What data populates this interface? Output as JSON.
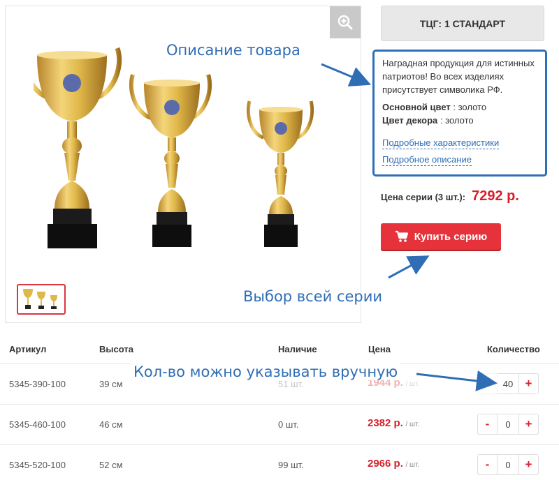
{
  "series_tag": "ТЦГ: 1 СТАНДАРТ",
  "description": {
    "text": "Наградная продукция для истинных патриотов! Во всех изделиях присутствует символика РФ.",
    "main_color_label": "Основной цвет",
    "main_color_value": ": золото",
    "decor_color_label": "Цвет декора",
    "decor_color_value": ": золото",
    "link_specs": "Подробные характеристики",
    "link_description": "Подробное описание"
  },
  "price": {
    "label": "Цена серии (3 шт.):",
    "value": "7292 р."
  },
  "buy_button": "Купить серию",
  "annotations": {
    "description": "Описание товара",
    "series": "Выбор всей серии",
    "quantity": "Кол-во можно указывать вручную"
  },
  "table": {
    "headers": {
      "article": "Артикул",
      "height": "Высота",
      "stock": "Наличие",
      "price": "Цена",
      "quantity": "Количество"
    },
    "rows": [
      {
        "article": "5345-390-100",
        "height": "39 см",
        "stock": "51 шт.",
        "price": "1944 р.",
        "unit": "/ шт.",
        "qty": "40"
      },
      {
        "article": "5345-460-100",
        "height": "46 см",
        "stock": "0 шт.",
        "price": "2382 р.",
        "unit": "/ шт.",
        "qty": "0"
      },
      {
        "article": "5345-520-100",
        "height": "52 см",
        "stock": "99 шт.",
        "price": "2966 р.",
        "unit": "/ шт.",
        "qty": "0"
      }
    ],
    "minus": "-",
    "plus": "+"
  },
  "colors": {
    "accent_red": "#e5323b",
    "annotation_blue": "#2f6eb5",
    "gold": "#e0b84a"
  },
  "icons": [
    "zoom-in-icon",
    "cart-icon",
    "trophy-image"
  ]
}
